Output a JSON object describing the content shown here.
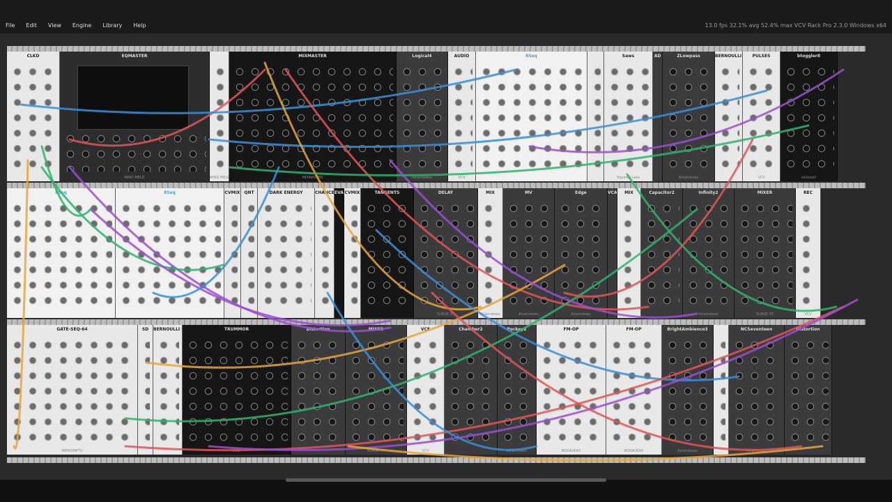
{
  "menu": {
    "items": [
      "File",
      "Edit",
      "View",
      "Engine",
      "Library",
      "Help"
    ],
    "status": "13.0 fps  32.1% avg  52.4% max    VCV Rack Pro 2.3.0 Windows x64"
  },
  "rows": [
    [
      {
        "name": "CLKD",
        "w": 76,
        "theme": "light"
      },
      {
        "name": "EQMASTER",
        "w": 215,
        "theme": "dark",
        "footer": "MIND MELD"
      },
      {
        "name": "",
        "w": 28,
        "theme": "light",
        "footer": "MIND MELD"
      },
      {
        "name": "MIXMASTER",
        "w": 240,
        "theme": "black",
        "footer": "MIXMASTER"
      },
      {
        "name": "Logical4",
        "w": 74,
        "theme": "grey",
        "footer": "Airwindows"
      },
      {
        "name": "AUDIO",
        "w": 40,
        "theme": "light",
        "footer": "VCV"
      },
      {
        "name": "8Seq",
        "w": 160,
        "theme": "pale",
        "blue": true
      },
      {
        "name": "",
        "w": 24,
        "theme": "light"
      },
      {
        "name": "Saws",
        "w": 70,
        "theme": "light",
        "footer": "Squinky Labs"
      },
      {
        "name": "AD",
        "w": 14,
        "theme": "grey"
      },
      {
        "name": "ZLowpass",
        "w": 75,
        "theme": "grey",
        "footer": "Airwindows"
      },
      {
        "name": "BERNOULLI SWITCH",
        "w": 40,
        "theme": "light"
      },
      {
        "name": "PULSES",
        "w": 54,
        "theme": "light",
        "footer": "VCV"
      },
      {
        "name": "btoggler8",
        "w": 82,
        "theme": "black",
        "footer": "sickozell"
      }
    ],
    [
      {
        "name": "8Seq",
        "w": 156,
        "theme": "pale",
        "blue": true
      },
      {
        "name": "8Seq",
        "w": 156,
        "theme": "pale",
        "blue": true
      },
      {
        "name": "CVMIX",
        "w": 24,
        "theme": "light"
      },
      {
        "name": "QNT",
        "w": 24,
        "theme": "light"
      },
      {
        "name": "DARK ENERGY",
        "w": 82,
        "theme": "light"
      },
      {
        "name": "CHANCES",
        "w": 28,
        "theme": "light"
      },
      {
        "name": "EVA",
        "w": 14,
        "theme": "black"
      },
      {
        "name": "CVMIX",
        "w": 24,
        "theme": "light"
      },
      {
        "name": "TANGENTS",
        "w": 76,
        "theme": "black"
      },
      {
        "name": "DELAY",
        "w": 92,
        "theme": "grey",
        "footer": "SURGE XT"
      },
      {
        "name": "MIX",
        "w": 36,
        "theme": "light",
        "footer": "Airwindows"
      },
      {
        "name": "MV",
        "w": 74,
        "theme": "grey",
        "footer": "Airwindows"
      },
      {
        "name": "Edge",
        "w": 76,
        "theme": "grey",
        "footer": "Airwindows"
      },
      {
        "name": "VCAS",
        "w": 14,
        "theme": "grey"
      },
      {
        "name": "MIX",
        "w": 34,
        "theme": "light"
      },
      {
        "name": "Capacitor2",
        "w": 60,
        "theme": "grey"
      },
      {
        "name": "Infinity2",
        "w": 74,
        "theme": "grey",
        "footer": "Airwindows"
      },
      {
        "name": "MIXER",
        "w": 88,
        "theme": "grey",
        "footer": "SURGE XT"
      },
      {
        "name": "REC",
        "w": 36,
        "theme": "light",
        "footer": "VCV"
      }
    ],
    [
      {
        "name": "GATE-SEQ-64",
        "w": 188,
        "theme": "light",
        "footer": "IMPROMPTU"
      },
      {
        "name": "SD",
        "w": 22,
        "theme": "light"
      },
      {
        "name": "BERNOULLI SWITCH",
        "w": 42,
        "theme": "light"
      },
      {
        "name": "TRUMMOR",
        "w": 156,
        "theme": "black",
        "footer": "VULT"
      },
      {
        "name": "Distortion",
        "w": 78,
        "theme": "grey"
      },
      {
        "name": "MIXER",
        "w": 88,
        "theme": "grey",
        "footer": "SURGE XT"
      },
      {
        "name": "VCF",
        "w": 54,
        "theme": "light",
        "footer": "VCV"
      },
      {
        "name": "Chamber2",
        "w": 76,
        "theme": "grey"
      },
      {
        "name": "Pockey2",
        "w": 56,
        "theme": "grey",
        "footer": "Airwindows"
      },
      {
        "name": "FM-OP",
        "w": 100,
        "theme": "light",
        "footer": "BOGAUDIO"
      },
      {
        "name": "FM-OP",
        "w": 80,
        "theme": "light",
        "footer": "BOGAUDIO"
      },
      {
        "name": "BrightAmbience3",
        "w": 74,
        "theme": "grey",
        "footer": "Airwindows"
      },
      {
        "name": "",
        "w": 22,
        "theme": "light"
      },
      {
        "name": "NCSeventeen",
        "w": 80,
        "theme": "grey",
        "footer": "Airwindows"
      },
      {
        "name": "Distortion",
        "w": 68,
        "theme": "grey"
      }
    ]
  ]
}
